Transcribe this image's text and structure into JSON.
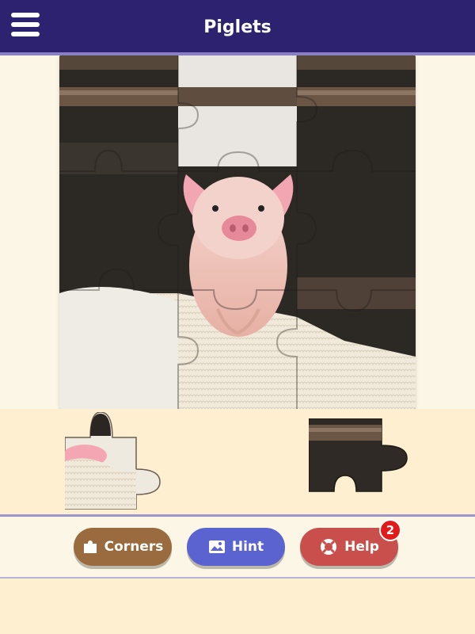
{
  "header": {
    "title": "Piglets",
    "menu_icon": "hamburger-menu-icon"
  },
  "board": {
    "columns": 3,
    "rows": 3,
    "missing_pieces": [
      3,
      2
    ]
  },
  "buttons": {
    "corners": {
      "label": "Corners",
      "icon": "puzzle-piece-icon",
      "color": "#9a6b3f"
    },
    "hint": {
      "label": "Hint",
      "icon": "image-icon",
      "color": "#5a63cf"
    },
    "help": {
      "label": "Help",
      "icon": "life-ring-icon",
      "color": "#c84f4b",
      "badge": "2"
    }
  },
  "colors": {
    "header": "#2d2270",
    "tray": "#fdefcf",
    "background": "#fbf6e6"
  }
}
